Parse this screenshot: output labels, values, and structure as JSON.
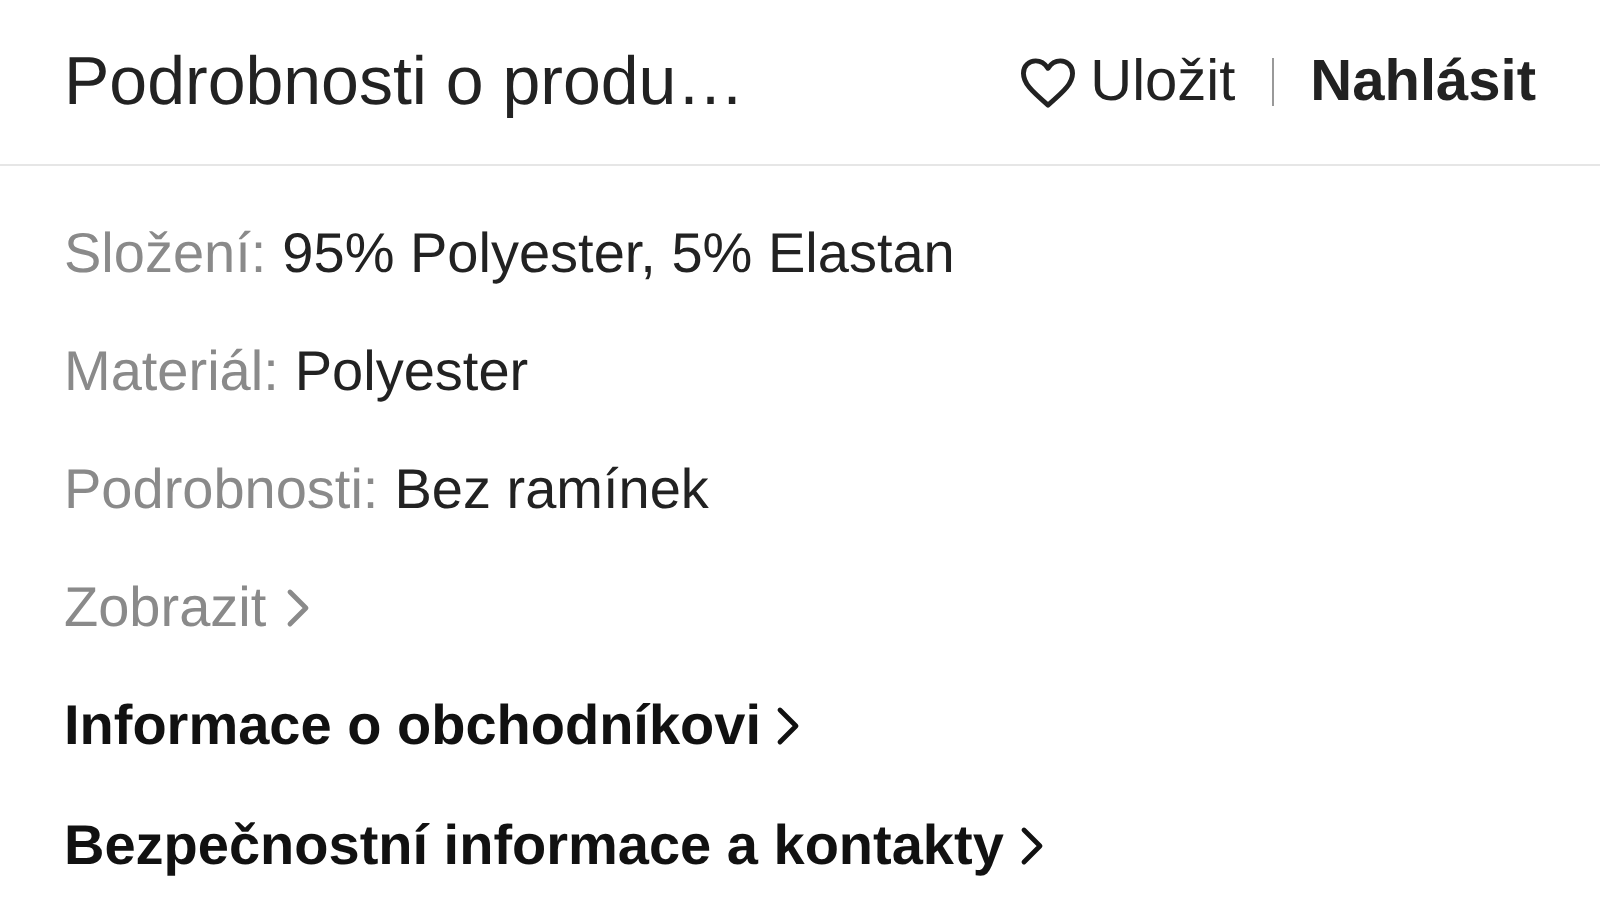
{
  "header": {
    "title": "Podrobnosti o produ…",
    "save_label": "Uložit",
    "report_label": "Nahlásit"
  },
  "details": [
    {
      "label": "Složení:",
      "value": "95% Polyester, 5% Elastan"
    },
    {
      "label": "Materiál:",
      "value": "Polyester"
    },
    {
      "label": "Podrobnosti:",
      "value": "Bez ramínek"
    }
  ],
  "show_more": {
    "label": "Zobrazit"
  },
  "links": [
    "Informace o obchodníkovi",
    "Bezpečnostní informace a kontakty"
  ]
}
